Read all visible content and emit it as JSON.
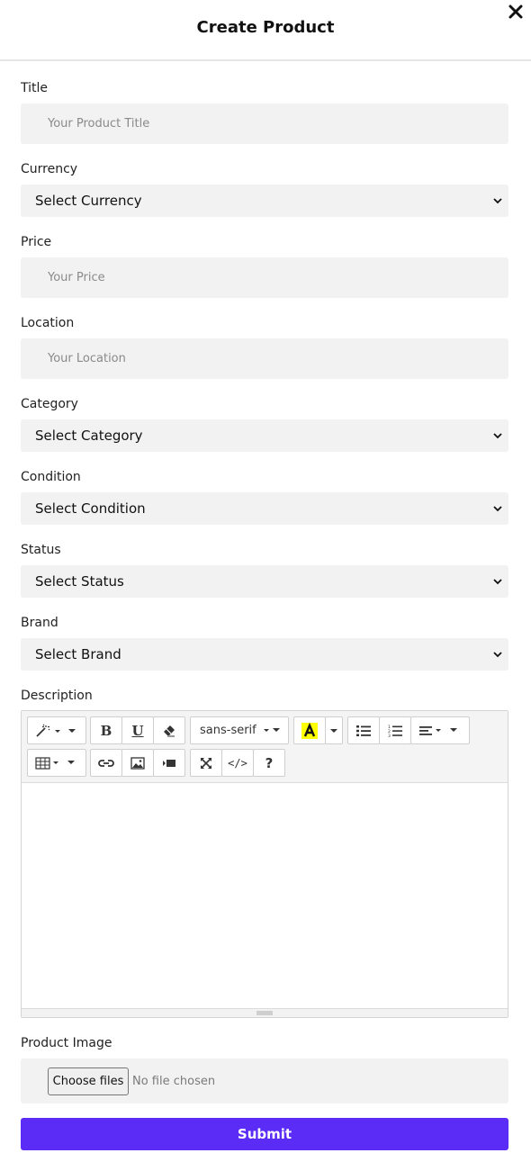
{
  "modal": {
    "title": "Create Product",
    "close_icon": "close-icon"
  },
  "fields": {
    "title": {
      "label": "Title",
      "placeholder": "Your Product Title",
      "value": ""
    },
    "currency": {
      "label": "Currency",
      "selected": "Select Currency"
    },
    "price": {
      "label": "Price",
      "placeholder": "Your Price",
      "value": ""
    },
    "location": {
      "label": "Location",
      "placeholder": "Your Location",
      "value": ""
    },
    "category": {
      "label": "Category",
      "selected": "Select Category"
    },
    "condition": {
      "label": "Condition",
      "selected": "Select Condition"
    },
    "status": {
      "label": "Status",
      "selected": "Select Status"
    },
    "brand": {
      "label": "Brand",
      "selected": "Select Brand"
    }
  },
  "description": {
    "label": "Description",
    "toolbar": {
      "style_icon": "magic-wand-icon",
      "bold_icon": "bold-icon",
      "underline_icon": "underline-icon",
      "clear_format_icon": "eraser-icon",
      "font_family": "sans-serif",
      "color_icon": "text-color-icon",
      "color_highlight": "#ffff00",
      "unordered_list_icon": "bulleted-list-icon",
      "ordered_list_icon": "numbered-list-icon",
      "align_icon": "align-left-icon",
      "table_icon": "table-icon",
      "link_icon": "link-icon",
      "picture_icon": "image-icon",
      "video_icon": "video-icon",
      "fullscreen_icon": "fullscreen-icon",
      "code_view_label": "</>",
      "help_label": "?"
    },
    "content": ""
  },
  "product_image": {
    "label": "Product Image",
    "choose_button": "Choose files",
    "status": "No file chosen"
  },
  "submit": {
    "label": "Submit"
  },
  "colors": {
    "accent": "#5b2cf6",
    "field_background": "#f2f2f2",
    "placeholder": "#8a8a8a"
  }
}
